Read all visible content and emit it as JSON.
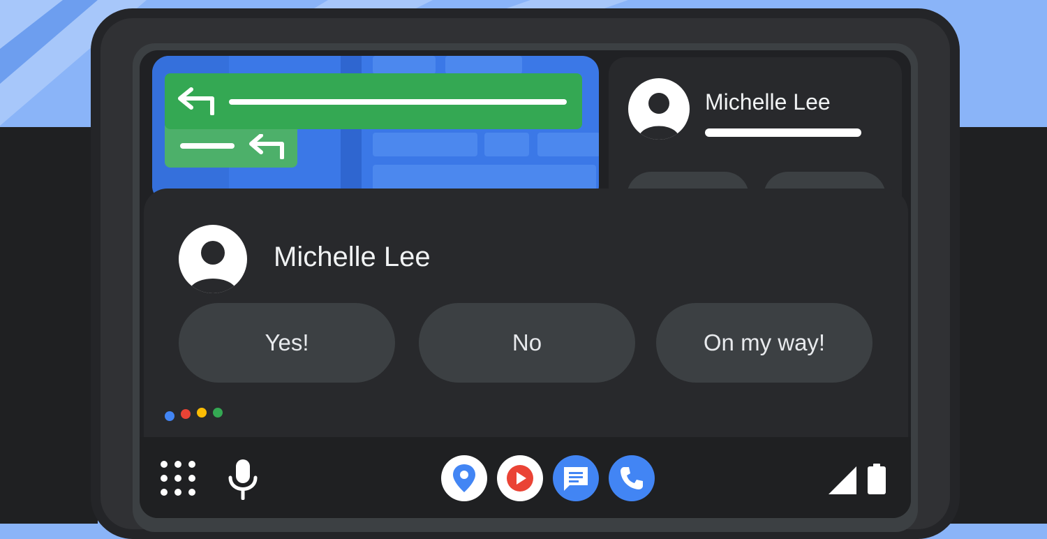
{
  "notification": {
    "contact_name": "Michelle Lee",
    "replies": [
      "Yes!",
      "No",
      "On my way!"
    ]
  },
  "message_card": {
    "contact_name": "Michelle Lee"
  },
  "colors": {
    "map_blue": "#3b78e7",
    "nav_green": "#34a853",
    "assistant_blue": "#4285f4",
    "assistant_red": "#ea4335",
    "assistant_yellow": "#fbbc04",
    "assistant_green": "#34a853",
    "panel_dark": "#28292c",
    "pill_gray": "#3c4043"
  },
  "bottom_bar": {
    "left_icons": [
      "app-launcher-icon",
      "microphone-icon"
    ],
    "apps": [
      "maps-icon",
      "youtube-music-icon",
      "messages-icon",
      "phone-icon"
    ],
    "right_icons": [
      "signal-icon",
      "battery-icon"
    ]
  }
}
